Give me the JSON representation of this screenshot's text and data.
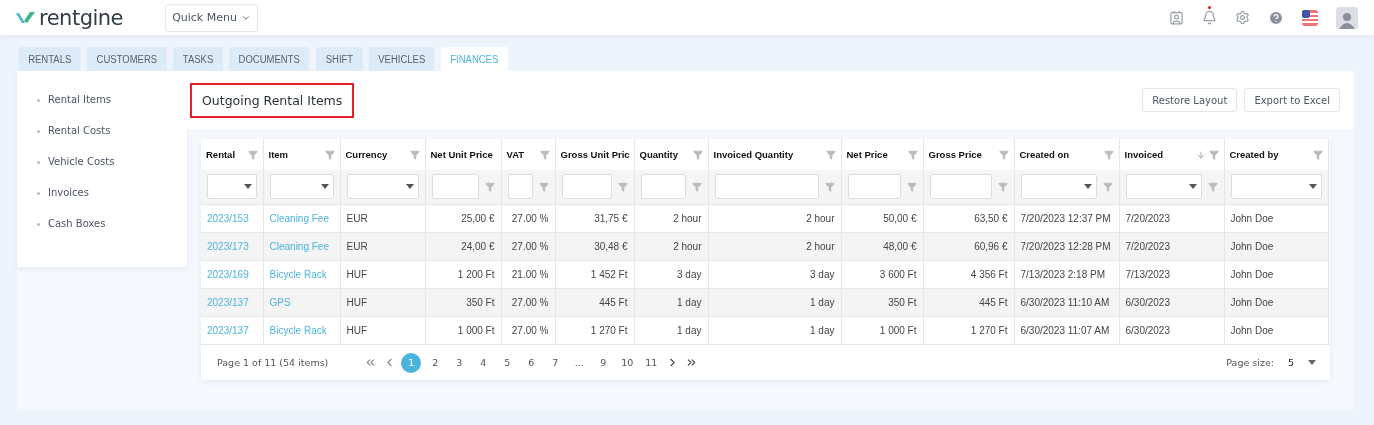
{
  "header": {
    "logo": "rentgine",
    "quick_menu": "Quick Menu",
    "notification_dot": true
  },
  "tabs": [
    {
      "label": "RENTALS",
      "selected": false
    },
    {
      "label": "CUSTOMERS",
      "selected": false
    },
    {
      "label": "TASKS",
      "selected": false
    },
    {
      "label": "DOCUMENTS",
      "selected": false
    },
    {
      "label": "SHIFT",
      "selected": false
    },
    {
      "label": "VEHICLES",
      "selected": false
    },
    {
      "label": "FINANCES",
      "selected": true
    }
  ],
  "sidebar": {
    "items": [
      "Rental Items",
      "Rental Costs",
      "Vehicle Costs",
      "Invoices",
      "Cash Boxes"
    ]
  },
  "page_title": "Outgoing Rental Items",
  "buttons": [
    "Restore Layout",
    "Export to Excel"
  ],
  "table": {
    "columns": [
      {
        "label": "Rental",
        "kind": "link",
        "filter": {
          "kind": "dropdown",
          "icon": false
        }
      },
      {
        "label": "Item",
        "kind": "link",
        "filter": {
          "kind": "dropdown",
          "icon": false
        }
      },
      {
        "label": "Currency",
        "kind": "text",
        "filter": {
          "kind": "dropdown",
          "icon": false
        }
      },
      {
        "label": "Net Unit Price",
        "kind": "number",
        "filter": {
          "kind": "field",
          "icon": true
        }
      },
      {
        "label": "VAT",
        "kind": "number",
        "filter": {
          "kind": "field",
          "icon": true
        }
      },
      {
        "label": "Gross Unit Pric",
        "kind": "number",
        "filter": {
          "kind": "field",
          "icon": true
        }
      },
      {
        "label": "Quantity",
        "kind": "number",
        "filter": {
          "kind": "field",
          "icon": true
        }
      },
      {
        "label": "Invoiced Quantity",
        "kind": "number",
        "filter": {
          "kind": "field",
          "icon": true
        }
      },
      {
        "label": "Net Price",
        "kind": "number",
        "filter": {
          "kind": "field",
          "icon": true
        }
      },
      {
        "label": "Gross Price",
        "kind": "number",
        "filter": {
          "kind": "field",
          "icon": true
        }
      },
      {
        "label": "Created on",
        "kind": "text",
        "filter": {
          "kind": "dropdown",
          "icon": true
        }
      },
      {
        "label": "Invoiced",
        "kind": "text",
        "filter": {
          "kind": "dropdown",
          "icon": true
        },
        "sorted_descending": true
      },
      {
        "label": "Created by",
        "kind": "text",
        "filter": {
          "kind": "dropdown",
          "icon": false
        }
      }
    ],
    "rows": [
      [
        "2023/153",
        "Cleaning Fee",
        "EUR",
        "25,00 €",
        "27.00 %",
        "31,75 €",
        "2 hour",
        "2 hour",
        "50,00 €",
        "63,50 €",
        "7/20/2023 12:37 PM",
        "7/20/2023",
        "John Doe"
      ],
      [
        "2023/173",
        "Cleaning Fee",
        "EUR",
        "24,00 €",
        "27.00 %",
        "30,48 €",
        "2 hour",
        "2 hour",
        "48,00 €",
        "60,96 €",
        "7/20/2023 12:28 PM",
        "7/20/2023",
        "John Doe"
      ],
      [
        "2023/169",
        "Bicycle Rack",
        "HUF",
        "1 200 Ft",
        "21.00 %",
        "1 452 Ft",
        "3 day",
        "3 day",
        "3 600 Ft",
        "4 356 Ft",
        "7/13/2023 2:18 PM",
        "7/13/2023",
        "John Doe"
      ],
      [
        "2023/137",
        "GPS",
        "HUF",
        "350 Ft",
        "27.00 %",
        "445 Ft",
        "1 day",
        "1 day",
        "350 Ft",
        "445 Ft",
        "6/30/2023 11:10 AM",
        "6/30/2023",
        "John Doe"
      ],
      [
        "2023/137",
        "Bicycle Rack",
        "HUF",
        "1 000 Ft",
        "27.00 %",
        "1 270 Ft",
        "1 day",
        "1 day",
        "1 000 Ft",
        "1 270 Ft",
        "6/30/2023 11:07 AM",
        "6/30/2023",
        "John Doe"
      ]
    ]
  },
  "pager": {
    "info": "Page 1 of 11 (54 items)",
    "pages": [
      {
        "label": "1",
        "selected": true
      },
      {
        "label": "2",
        "selected": false
      },
      {
        "label": "3",
        "selected": false
      },
      {
        "label": "4",
        "selected": false
      },
      {
        "label": "5",
        "selected": false
      },
      {
        "label": "6",
        "selected": false
      },
      {
        "label": "7",
        "selected": false
      },
      {
        "label": "...",
        "selected": false
      },
      {
        "label": "9",
        "selected": false
      },
      {
        "label": "10",
        "selected": false
      },
      {
        "label": "11",
        "selected": false
      }
    ],
    "page_size_label": "Page size:",
    "page_size": "5"
  }
}
